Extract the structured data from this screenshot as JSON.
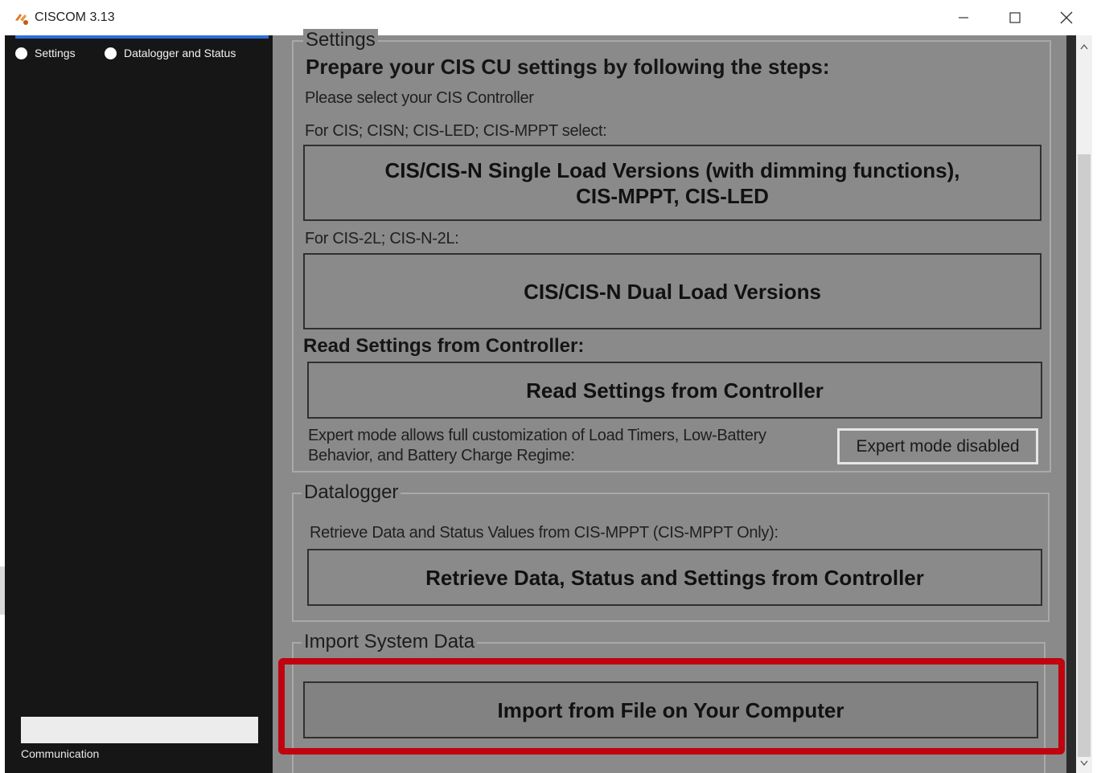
{
  "window": {
    "title": "CISCOM 3.13"
  },
  "sidebar": {
    "radios": [
      {
        "label": "Settings"
      },
      {
        "label": "Datalogger and Status"
      }
    ],
    "communication_label": "Communication"
  },
  "settings_group": {
    "legend": "Settings",
    "heading": "Prepare your CIS CU settings by following the steps:",
    "select_controller": "Please select your CIS Controller",
    "for_cis_label": "For CIS; CISN; CIS-LED; CIS-MPPT select:",
    "single_load_button": {
      "line1": "CIS/CIS-N Single Load Versions (with dimming functions),",
      "line2": "CIS-MPPT, CIS-LED"
    },
    "for_2l_label": "For CIS-2L; CIS-N-2L:",
    "dual_load_button": "CIS/CIS-N Dual Load Versions",
    "read_heading": "Read Settings from Controller:",
    "read_button": "Read Settings from Controller",
    "expert_text": "Expert mode allows full customization of Load Timers, Low-Battery Behavior, and Battery Charge Regime:",
    "expert_button": "Expert mode disabled"
  },
  "datalogger_group": {
    "legend": "Datalogger",
    "description": "Retrieve Data and Status Values from CIS-MPPT (CIS-MPPT Only):",
    "retrieve_button": "Retrieve Data, Status and Settings from Controller"
  },
  "import_group": {
    "legend": "Import System Data",
    "import_button": "Import from File on Your Computer"
  },
  "colors": {
    "sidebar_bg": "#161616",
    "main_bg": "#8a8a8a",
    "highlight": "#c0040f",
    "accent": "#2f6fd6"
  },
  "icons": {
    "app": "ciscom-app-icon",
    "minimize": "minimize-icon",
    "maximize": "maximize-icon",
    "close": "close-icon"
  }
}
